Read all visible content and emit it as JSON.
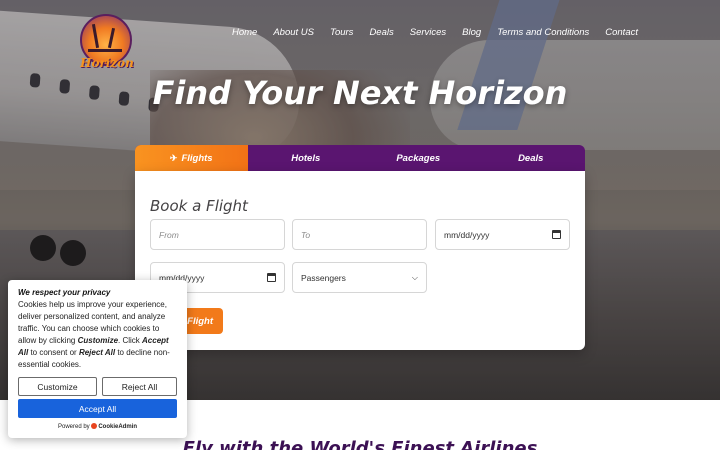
{
  "brand": {
    "name": "Horizon"
  },
  "nav": [
    {
      "label": "Home"
    },
    {
      "label": "About US"
    },
    {
      "label": "Tours"
    },
    {
      "label": "Deals"
    },
    {
      "label": "Services"
    },
    {
      "label": "Blog"
    },
    {
      "label": "Terms and Conditions"
    },
    {
      "label": "Contact"
    }
  ],
  "hero": {
    "title": "Find Your Next Horizon"
  },
  "booking": {
    "tabs": [
      {
        "label": "Flights",
        "icon": "plane-icon",
        "glyph": "✈",
        "active": true
      },
      {
        "label": "Hotels",
        "icon": "hotel-icon",
        "glyph": "",
        "active": false
      },
      {
        "label": "Packages",
        "icon": "package-icon",
        "glyph": "",
        "active": false
      },
      {
        "label": "Deals",
        "icon": "tag-icon",
        "glyph": "",
        "active": false
      }
    ],
    "title": "Book a Flight",
    "from_placeholder": "From",
    "to_placeholder": "To",
    "depart_value": "mm/dd/yyyy",
    "return_value": "mm/dd/yyyy",
    "passengers_value": "Passengers",
    "search_label": "Flight"
  },
  "section": {
    "title": "Fly with the World's Finest Airlines"
  },
  "cookie": {
    "title": "We respect your privacy",
    "text_1": "Cookies help us improve your experience, deliver personalized content, and analyze traffic. You can choose which cookies to allow by clicking ",
    "text_customize": "Customize",
    "text_2": ". Click ",
    "text_accept": "Accept All",
    "text_3": " to consent or ",
    "text_reject": "Reject All",
    "text_4": " to decline non-essential cookies.",
    "customize_label": "Customize",
    "reject_label": "Reject All",
    "accept_label": "Accept All",
    "powered_label": "Powered by",
    "powered_brand": "CookieAdmin"
  },
  "colors": {
    "accent_orange": "#f27a1a",
    "tab_purple": "#5a1570",
    "accept_blue": "#1863dc",
    "heading_purple": "#3c1154"
  }
}
